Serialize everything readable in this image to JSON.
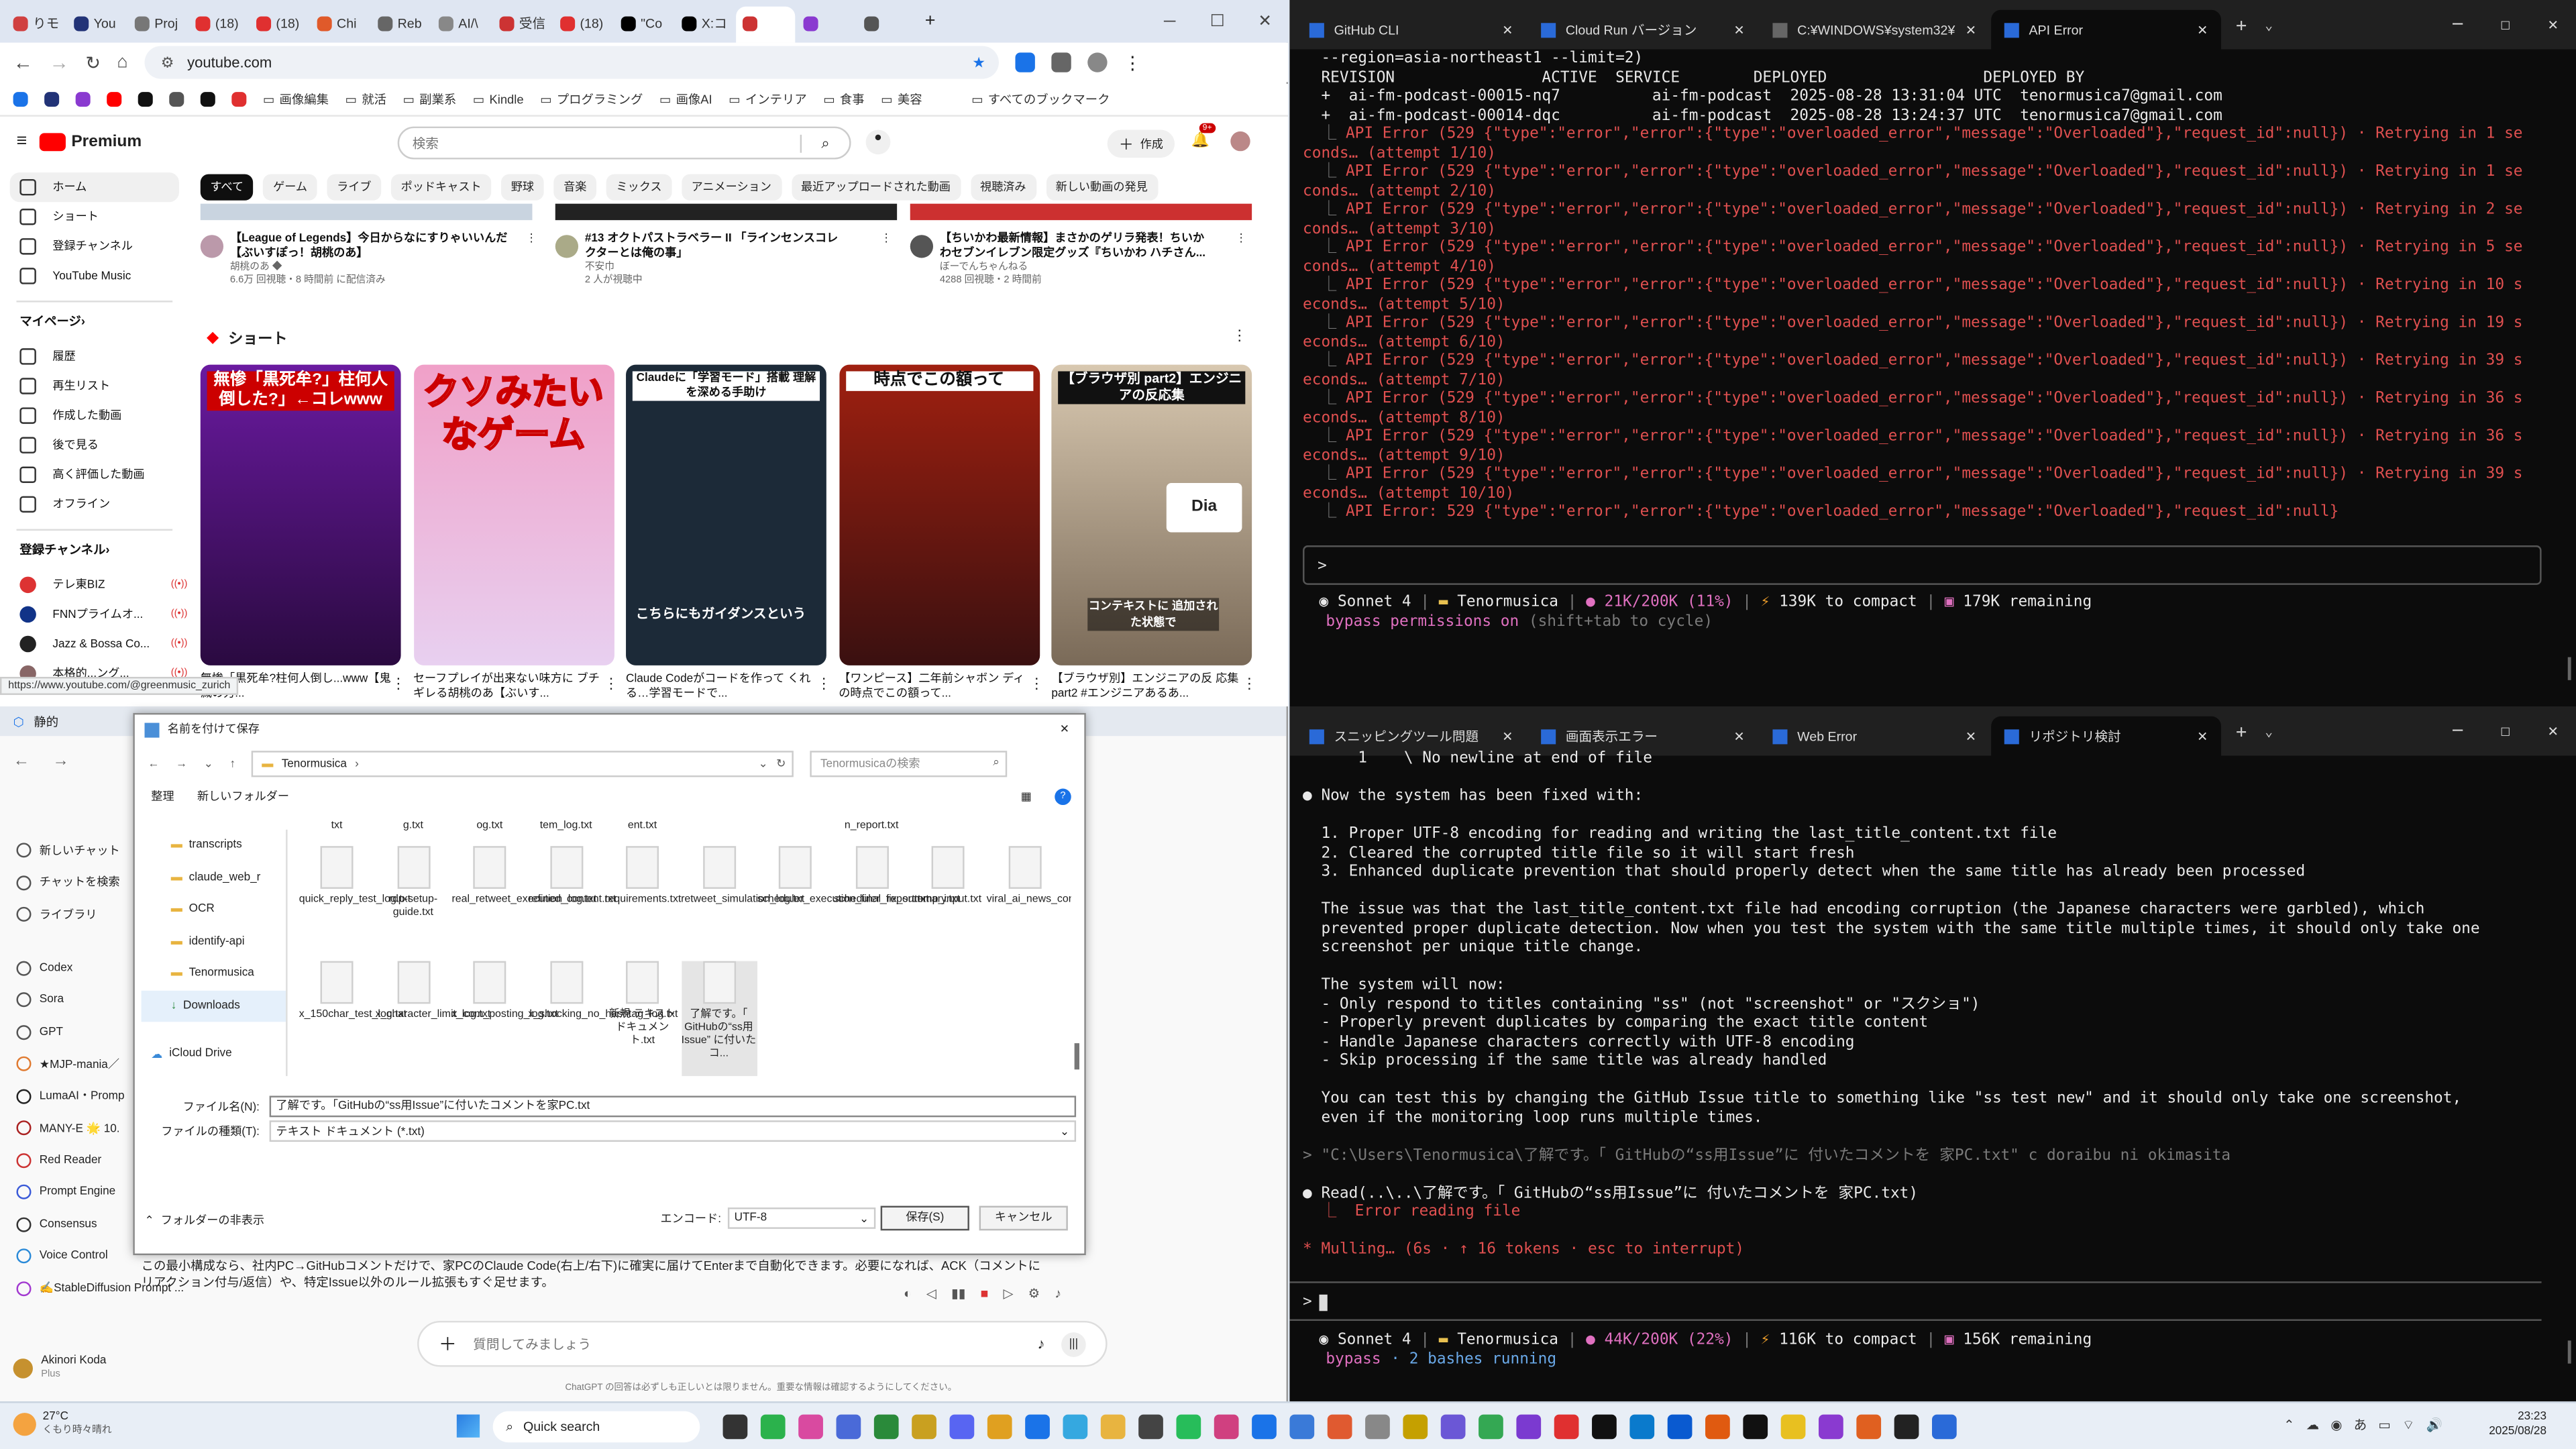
{
  "chrome": {
    "tabs": [
      "りモ",
      "You",
      "Proj",
      "(18)",
      "(18)",
      "Chi",
      "Reb",
      "AI/\\",
      "受信",
      "(18)",
      "\"Co",
      "X:コ",
      "",
      "",
      ""
    ],
    "url": "youtube.com",
    "bookmarks": [
      "画像編集",
      "就活",
      "副業系",
      "Kindle",
      "プログラミング",
      "画像AI",
      "インテリア",
      "食事",
      "美容",
      "すべてのブックマーク"
    ],
    "status_url": "https://www.youtube.com/@greenmusic_zurich"
  },
  "youtube": {
    "logo": "Premium",
    "logo_sup": "JP",
    "search_placeholder": "検索",
    "create_label": "作成",
    "notif_count": "9+",
    "sidebar": [
      "ホーム",
      "ショート",
      "登録チャンネル",
      "YouTube Music"
    ],
    "my_page": "マイページ",
    "my_items": [
      "履歴",
      "再生リスト",
      "作成した動画",
      "後で見る",
      "高く評価した動画",
      "オフライン"
    ],
    "subs_title": "登録チャンネル",
    "subs": [
      "テレ東BIZ",
      "FNNプライムオ...",
      "Jazz & Bossa Co...",
      "本格的...ング..."
    ],
    "chips": [
      "すべて",
      "ゲーム",
      "ライブ",
      "ポッドキャスト",
      "野球",
      "音楽",
      "ミックス",
      "アニメーション",
      "最近アップロードされた動画",
      "視聴済み",
      "新しい動画の発見"
    ],
    "videos": [
      {
        "title1": "【League of Legends】今日からなにすりゃいいんだ",
        "title2": "【ぶいすぽっ！胡桃のあ】",
        "meta1": "胡桃のあ ◆",
        "meta2": "6.6万 回視聴・8 時間前 に配信済み"
      },
      {
        "title1": "#13 オクトパストラベラー II 「ラインセンスコレ",
        "title2": "クターとは俺の事」",
        "meta1": "不安巾",
        "meta2": "2 人が視聴中"
      },
      {
        "title1": "【ちいかわ最新情報】まさかのゲリラ発表！ちいか",
        "title2": "わセブンイレブン限定グッズ『ちいかわ ハチさん...",
        "meta1": "ぼーでんちゃんねる",
        "meta2": "4288 回視聴・2 時間前"
      }
    ],
    "shorts_title": "ショート",
    "shorts": [
      {
        "thumb": "無惨「黒死牟?」柱何人倒した?」←コレwww",
        "title": "無惨「黒死牟?柱何人倒し...www【鬼滅の刃..."
      },
      {
        "thumb": "クソみたいなゲーム",
        "title": "セーフプレイが出来ない味方に ブチギレる胡桃のあ【ぶいす..."
      },
      {
        "thumb": "Claudeに「学習モード」搭載 理解を深める手助け",
        "title": "Claude Codeがコードを作って くれる…学習モードで..."
      },
      {
        "thumb": "時点でこの額って",
        "title": "【ワンピース】二年前シャボン ディの時点でこの額って..."
      },
      {
        "thumb": "【ブラウザ別 part2】エンジニアの反応集",
        "title": "【ブラウザ別】エンジニアの反 応集 part2 #エンジニアあるあ..."
      }
    ],
    "short_caption_a": "こちらにもガイダンスという",
    "short_caption_b": "コンテキストに 追加された状態で",
    "dia": "Dia"
  },
  "term_top": {
    "tabs": [
      "GitHub CLI",
      "Cloud Run バージョン",
      "C:¥WINDOWS¥system32¥cmd.",
      "API Error"
    ],
    "header": [
      "  --region=asia-northeast1 --limit=2)",
      "  REVISION                ACTIVE  SERVICE        DEPLOYED                 DEPLOYED BY",
      "  +  ai-fm-podcast-00015-nq7          ai-fm-podcast  2025-08-28 13:31:04 UTC  tenormusica7@gmail.com",
      "  +  ai-fm-podcast-00014-dqc          ai-fm-podcast  2025-08-28 13:24:37 UTC  tenormusica7@gmail.com"
    ],
    "errors": [
      [
        "API Error (529 {\"type\":\"error\",\"error\":{\"type\":\"overloaded_error\",\"message\":\"Overloaded\"},\"request_id\":null}) · Retrying in 1 se",
        "conds… (attempt 1/10)"
      ],
      [
        "API Error (529 {\"type\":\"error\",\"error\":{\"type\":\"overloaded_error\",\"message\":\"Overloaded\"},\"request_id\":null}) · Retrying in 1 se",
        "conds… (attempt 2/10)"
      ],
      [
        "API Error (529 {\"type\":\"error\",\"error\":{\"type\":\"overloaded_error\",\"message\":\"Overloaded\"},\"request_id\":null}) · Retrying in 2 se",
        "conds… (attempt 3/10)"
      ],
      [
        "API Error (529 {\"type\":\"error\",\"error\":{\"type\":\"overloaded_error\",\"message\":\"Overloaded\"},\"request_id\":null}) · Retrying in 5 se",
        "conds… (attempt 4/10)"
      ],
      [
        "API Error (529 {\"type\":\"error\",\"error\":{\"type\":\"overloaded_error\",\"message\":\"Overloaded\"},\"request_id\":null}) · Retrying in 10 s",
        "econds… (attempt 5/10)"
      ],
      [
        "API Error (529 {\"type\":\"error\",\"error\":{\"type\":\"overloaded_error\",\"message\":\"Overloaded\"},\"request_id\":null}) · Retrying in 19 s",
        "econds… (attempt 6/10)"
      ],
      [
        "API Error (529 {\"type\":\"error\",\"error\":{\"type\":\"overloaded_error\",\"message\":\"Overloaded\"},\"request_id\":null}) · Retrying in 39 s",
        "econds… (attempt 7/10)"
      ],
      [
        "API Error (529 {\"type\":\"error\",\"error\":{\"type\":\"overloaded_error\",\"message\":\"Overloaded\"},\"request_id\":null}) · Retrying in 36 s",
        "econds… (attempt 8/10)"
      ],
      [
        "API Error (529 {\"type\":\"error\",\"error\":{\"type\":\"overloaded_error\",\"message\":\"Overloaded\"},\"request_id\":null}) · Retrying in 36 s",
        "econds… (attempt 9/10)"
      ],
      [
        "API Error (529 {\"type\":\"error\",\"error\":{\"type\":\"overloaded_error\",\"message\":\"Overloaded\"},\"request_id\":null}) · Retrying in 39 s",
        "econds… (attempt 10/10)"
      ]
    ],
    "final_error": "API Error: 529 {\"type\":\"error\",\"error\":{\"type\":\"overloaded_error\",\"message\":\"Overloaded\"},\"request_id\":null}",
    "prompt": ">",
    "status": {
      "model": "Sonnet 4",
      "dir": "Tenormusica",
      "ctx": "21K/200K (11%)",
      "compact": "139K to compact",
      "remain": "179K remaining"
    },
    "mode": "bypass permissions on",
    "mode_hint": "(shift+tab to cycle)"
  },
  "term_bot": {
    "tabs": [
      "スニッピングツール問題",
      "画面表示エラー",
      "Web Error",
      "リポジトリ検討"
    ],
    "lines": [
      {
        "c": "wh",
        "t": "      1    \\ No newline at end of file"
      },
      {
        "c": "",
        "t": ""
      },
      {
        "c": "wh",
        "t": "● Now the system has been fixed with:"
      },
      {
        "c": "",
        "t": ""
      },
      {
        "c": "wh",
        "t": "  1. Proper UTF-8 encoding for reading and writing the last_title_content.txt file"
      },
      {
        "c": "wh",
        "t": "  2. Cleared the corrupted title file so it will start fresh"
      },
      {
        "c": "wh",
        "t": "  3. Enhanced duplicate prevention that should properly detect when the same title has already been processed"
      },
      {
        "c": "",
        "t": ""
      },
      {
        "c": "wh",
        "t": "  The issue was that the last_title_content.txt file had encoding corruption (the Japanese characters were garbled), which"
      },
      {
        "c": "wh",
        "t": "  prevented proper duplicate detection. Now when you test the system with the same title multiple times, it should only take one"
      },
      {
        "c": "wh",
        "t": "  screenshot per unique title change."
      },
      {
        "c": "",
        "t": ""
      },
      {
        "c": "wh",
        "t": "  The system will now:"
      },
      {
        "c": "wh",
        "t": "  - Only respond to titles containing \"ss\" (not \"screenshot\" or \"スクショ\")"
      },
      {
        "c": "wh",
        "t": "  - Properly prevent duplicates by comparing the exact title content"
      },
      {
        "c": "wh",
        "t": "  - Handle Japanese characters correctly with UTF-8 encoding"
      },
      {
        "c": "wh",
        "t": "  - Skip processing if the same title was already handled"
      },
      {
        "c": "",
        "t": ""
      },
      {
        "c": "wh",
        "t": "  You can test this by changing the GitHub Issue title to something like \"ss test new\" and it should only take one screenshot,"
      },
      {
        "c": "wh",
        "t": "  even if the monitoring loop runs multiple times."
      },
      {
        "c": "",
        "t": ""
      },
      {
        "c": "gr",
        "t": "> \"C:\\Users\\Tenormusica\\了解です。「 GitHubの“ss用Issue”に 付いたコメントを 家PC.txt\" c doraibu ni okimasita"
      },
      {
        "c": "",
        "t": ""
      },
      {
        "c": "wh",
        "t": "● Read(..\\..\\了解です。「 GitHubの“ss用Issue”に 付いたコメントを 家PC.txt)"
      },
      {
        "c": "red",
        "t": "  ⎿  Error reading file"
      },
      {
        "c": "",
        "t": ""
      },
      {
        "c": "red",
        "t": "* Mulling… (6s · ↑ 16 tokens · esc to interrupt)"
      }
    ],
    "prompt": ">",
    "status": {
      "model": "Sonnet 4",
      "dir": "Tenormusica",
      "ctx": "44K/200K (22%)",
      "compact": "116K to compact",
      "remain": "156K remaining"
    },
    "mode": "bypass",
    "mode_hint": "· 2 bashes running"
  },
  "chatgpt": {
    "title": "静的",
    "sidebar": [
      "新しいチャット",
      "チャットを検索",
      "ライブラリ",
      "Codex",
      "Sora",
      "GPT",
      "★MJP-mania／",
      "LumaAI・Promp",
      "MANY-E 🌟 10.",
      "Red Reader",
      "Prompt Engine",
      "Consensus",
      "Voice Control",
      "✍️StableDiffusion Prompt ..."
    ],
    "user": "Akinori Koda",
    "plan": "Plus",
    "body_text1": "この最小構成なら、社内PC→GitHubコメントだけで、家PCのClaude Code(右上/右下)に確実に届けてEnterまで自動化できます。必要になれば、ACK（コメントに",
    "body_text2": "リアクション付与/返信）や、特定Issue以外のルール拡張もすぐ足せます。",
    "input_placeholder": "質問してみましょう",
    "disclaimer": "ChatGPT の回答は必ずしも正しいとは限りません。重要な情報は確認するようにしてください。"
  },
  "dialog": {
    "title": "名前を付けて保存",
    "path": "Tenormusica",
    "search": "Tenormusicaの検索",
    "organize": "整理",
    "new_folder": "新しいフォルダー",
    "nav": [
      "transcripts",
      "claude_web_r",
      "OCR",
      "identify-api",
      "Tenormusica",
      "Downloads",
      "iCloud Drive"
    ],
    "files_row0": [
      "txt",
      "g.txt",
      "og.txt",
      "tem_log.txt",
      "ent.txt",
      "",
      "",
      "n_report.txt",
      ""
    ],
    "files_row1": [
      "quick_reply_test_log.txt",
      "rdp-setup-guide.txt",
      "real_retweet_execution_log.txt",
      "refined_content.txt",
      "requirements.txt",
      "retweet_simulation_log.txt",
      "scheduler_execution_final_report.txt",
      "scheduler_fix_summary.txt",
      "temp_input.txt",
      "viral_ai_news_content.txt"
    ],
    "files_row2": [
      "x_150char_test_log.txt",
      "x_character_limit_log.txt",
      "x_com_posting_log.txt",
      "x_shocking_no_hashtag_log.txt",
      "新規 テキスト ドキュメント.txt",
      "了解です。「 GitHubの“ss用Issue” に付いたコ..."
    ],
    "filename_label": "ファイル名(N):",
    "filename": "了解です。「GitHubの“ss用Issue”に付いたコメントを家PC.txt",
    "type_label": "ファイルの種類(T):",
    "type": "テキスト ドキュメント (*.txt)",
    "hide_folders": "フォルダーの非表示",
    "encoding_label": "エンコード:",
    "encoding": "UTF-8",
    "save": "保存(S)",
    "cancel": "キャンセル"
  },
  "taskbar": {
    "weather_temp": "27°C",
    "weather_desc": "くもり時々晴れ",
    "search": "Quick search",
    "time": "23:23",
    "date": "2025/08/28"
  }
}
